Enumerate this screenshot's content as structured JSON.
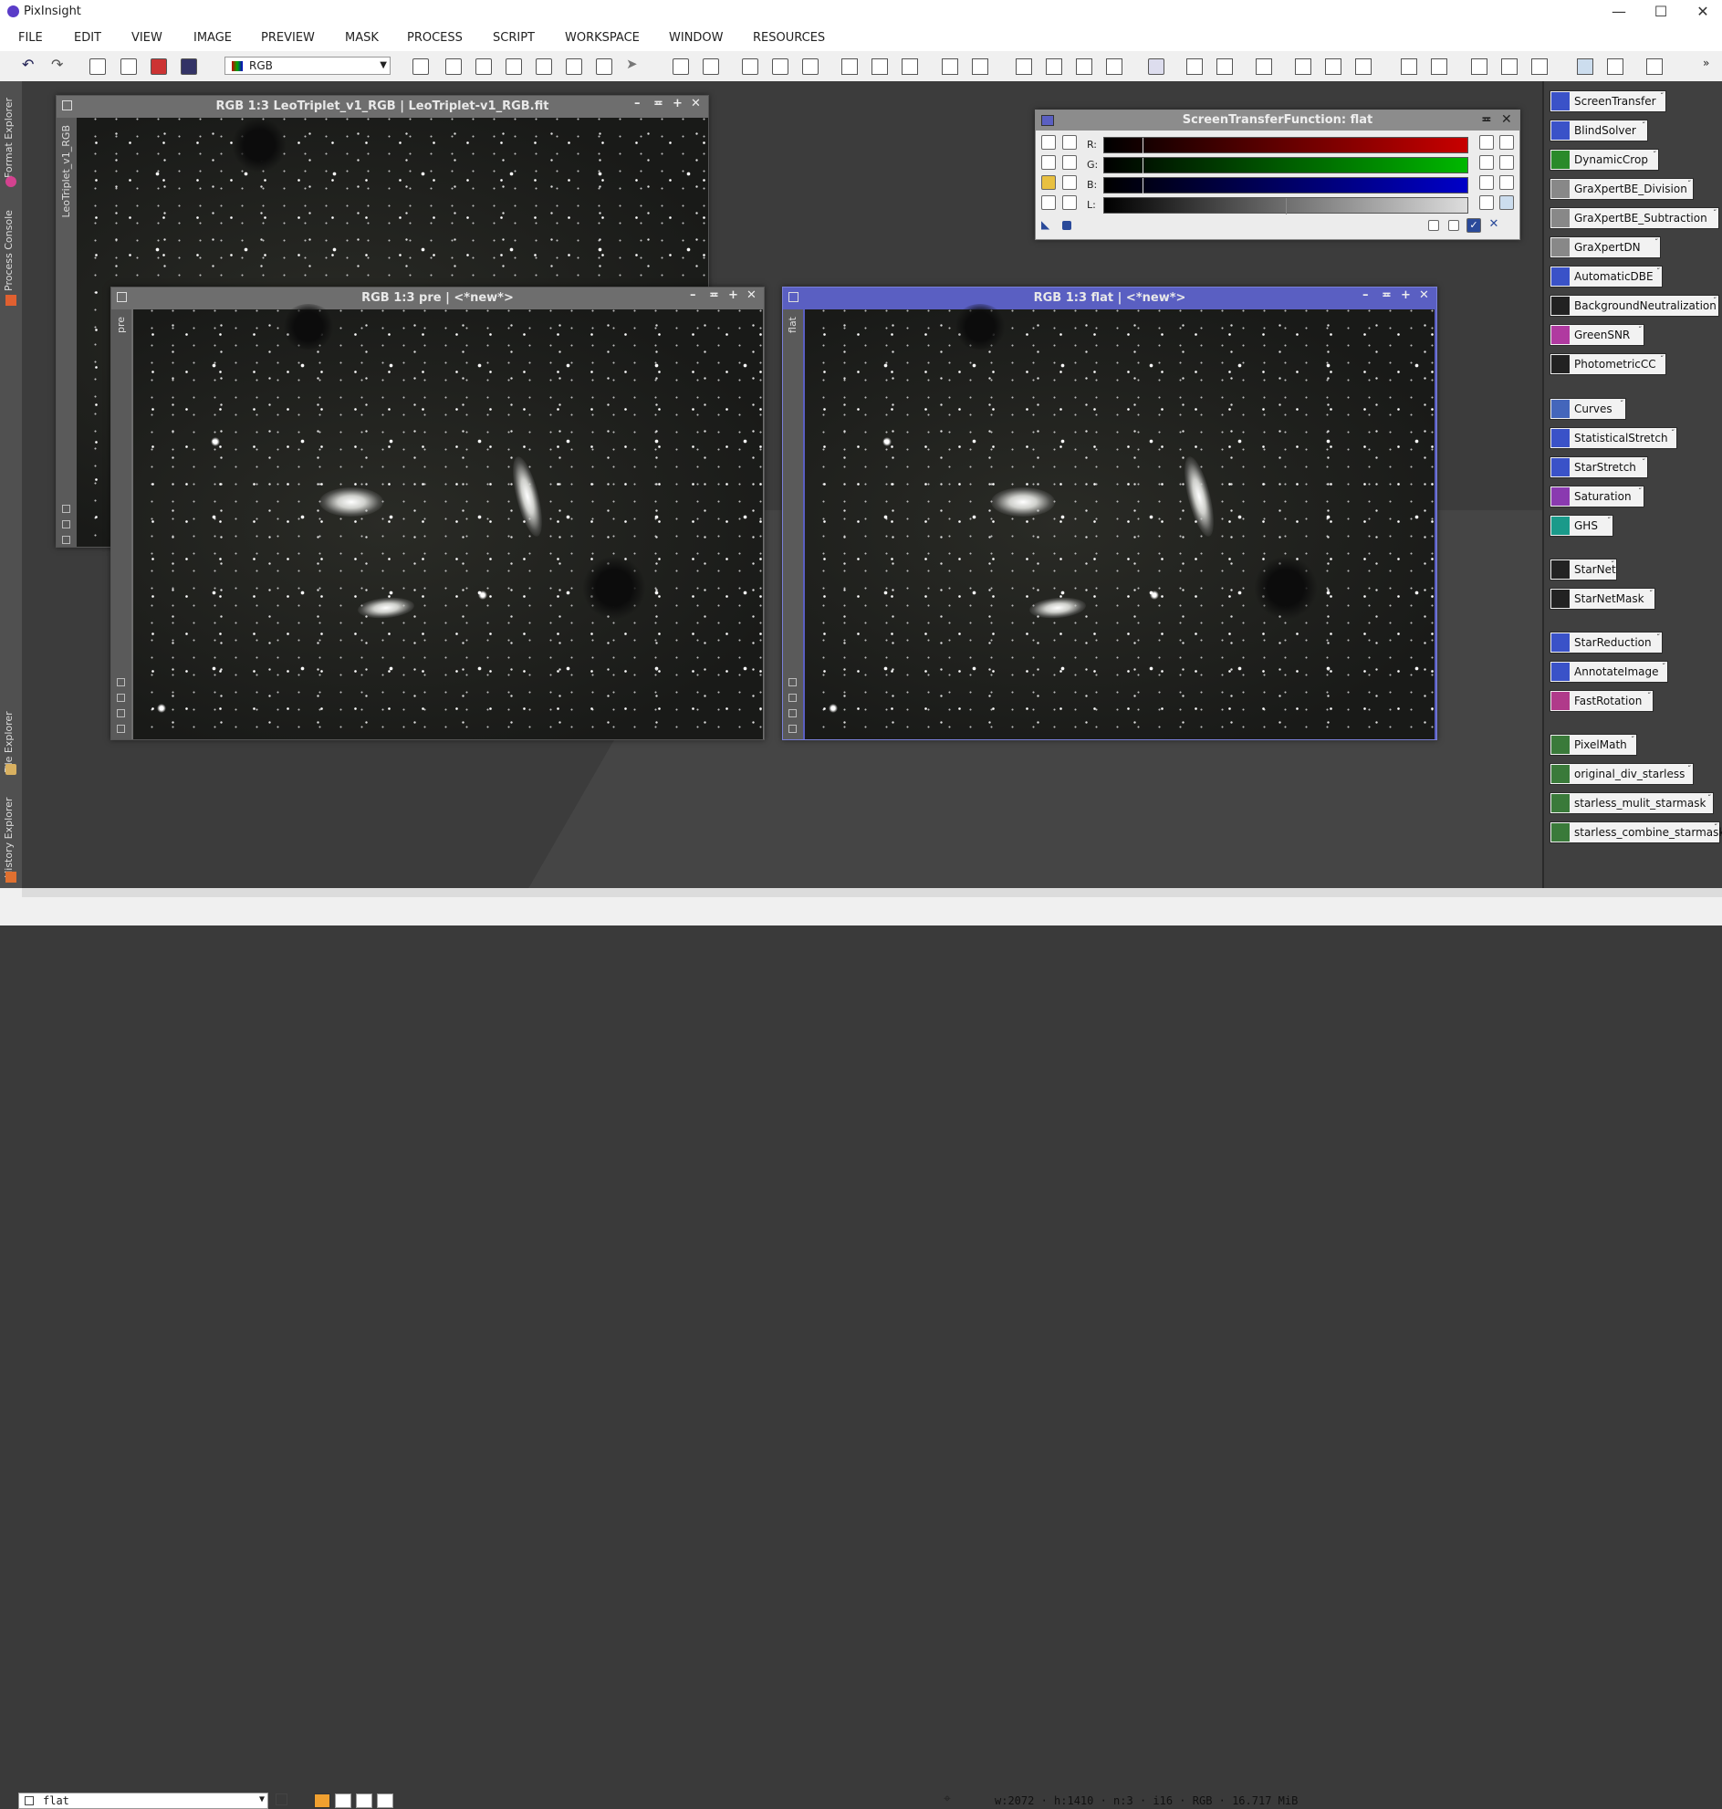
{
  "app": {
    "title": "PixInsight"
  },
  "window_controls": {
    "minimize": "—",
    "maximize": "☐",
    "close": "✕"
  },
  "menus": [
    "FILE",
    "EDIT",
    "VIEW",
    "IMAGE",
    "PREVIEW",
    "MASK",
    "PROCESS",
    "SCRIPT",
    "WORKSPACE",
    "WINDOW",
    "RESOURCES"
  ],
  "toolbar": {
    "color_space": "RGB"
  },
  "left_tabs": [
    "Format Explorer",
    "Process Console",
    "File Explorer",
    "History Explorer"
  ],
  "windows": {
    "leo": {
      "title": "RGB 1:3 LeoTriplet_v1_RGB | LeoTriplet-v1_RGB.fit",
      "side_label": "LeoTriplet_v1_RGB"
    },
    "pre": {
      "title": "RGB 1:3 pre | <*new*>",
      "side_label": "pre"
    },
    "flat": {
      "title": "RGB 1:3 flat | <*new*>",
      "side_label": "flat"
    },
    "controls": {
      "min": "–",
      "shade": "≖",
      "max": "+",
      "close": "✕"
    }
  },
  "stf": {
    "title": "ScreenTransferFunction: flat",
    "channels": [
      {
        "label": "R:",
        "color": "#c80000"
      },
      {
        "label": "G:",
        "color": "#00b800"
      },
      {
        "label": "B:",
        "color": "#0000c8"
      },
      {
        "label": "L:",
        "color": "#cccccc"
      }
    ]
  },
  "process_icons": [
    {
      "label": "ScreenTransfer",
      "icon": "stf-icon",
      "color": "#3a52c8"
    },
    {
      "label": "BlindSolver",
      "icon": "script-icon",
      "color": "#3a52c8"
    },
    {
      "label": "DynamicCrop",
      "icon": "crop-icon",
      "color": "#2a8a2a"
    },
    {
      "label": "GraXpertBE_Division",
      "icon": "gear-icon",
      "color": "#888888"
    },
    {
      "label": "GraXpertBE_Subtraction",
      "icon": "gear-icon",
      "color": "#888888"
    },
    {
      "label": "GraXpertDN",
      "icon": "gear-icon",
      "color": "#888888"
    },
    {
      "label": "AutomaticDBE",
      "icon": "script-icon",
      "color": "#3a52c8"
    },
    {
      "label": "BackgroundNeutralization",
      "icon": "bn-icon",
      "color": "#222222"
    },
    {
      "label": "GreenSNR",
      "icon": "snr-icon",
      "color": "#b03aa0"
    },
    {
      "label": "PhotometricCC",
      "icon": "pcc-icon",
      "color": "#222222"
    },
    {
      "label": "Curves",
      "icon": "curves-icon",
      "color": "#4466bb"
    },
    {
      "label": "StatisticalStretch",
      "icon": "script-icon",
      "color": "#3a52c8"
    },
    {
      "label": "StarStretch",
      "icon": "script-icon",
      "color": "#3a52c8"
    },
    {
      "label": "Saturation",
      "icon": "saturation-icon",
      "color": "#8a3ab0"
    },
    {
      "label": "GHS",
      "icon": "ghs-icon",
      "color": "#1a9a8a"
    },
    {
      "label": "StarNet",
      "icon": "starnet-icon",
      "color": "#222222"
    },
    {
      "label": "StarNetMask",
      "icon": "starnet-icon",
      "color": "#222222"
    },
    {
      "label": "StarReduction",
      "icon": "script-icon",
      "color": "#3a52c8"
    },
    {
      "label": "AnnotateImage",
      "icon": "script-icon",
      "color": "#3a52c8"
    },
    {
      "label": "FastRotation",
      "icon": "rotation-icon",
      "color": "#b03a8a"
    },
    {
      "label": "PixelMath",
      "icon": "pixelmath-icon",
      "color": "#3a7a3a"
    },
    {
      "label": "original_div_starless",
      "icon": "pixelmath-icon",
      "color": "#3a7a3a"
    },
    {
      "label": "starless_mulit_starmask",
      "icon": "pixelmath-icon",
      "color": "#3a7a3a"
    },
    {
      "label": "starless_combine_starmask",
      "icon": "pixelmath-icon",
      "color": "#3a7a3a"
    }
  ],
  "statusbar": {
    "view": "flat",
    "info": "w:2072 · h:1410 · n:3 · i16 · RGB · 16.717 MiB"
  }
}
